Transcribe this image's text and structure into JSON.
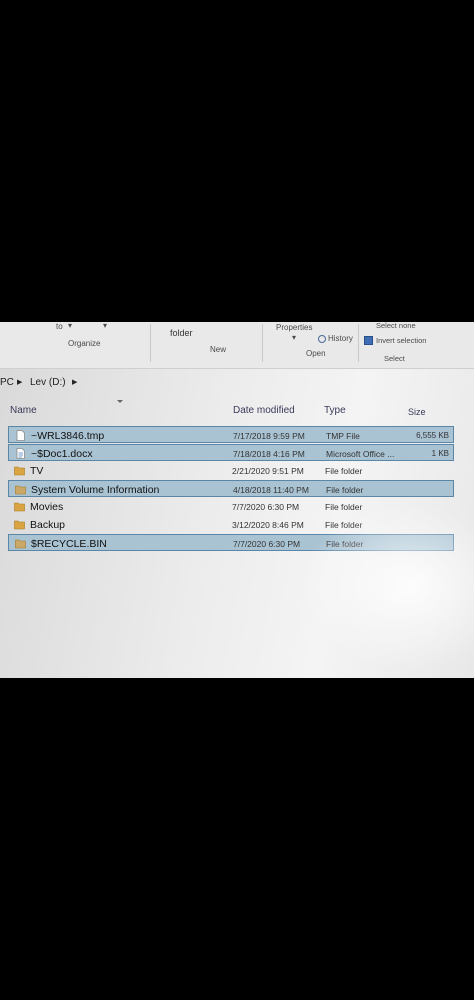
{
  "ribbon": {
    "to_label": "to",
    "folder_label": "folder",
    "organize_label": "Organize",
    "new_label": "New",
    "properties_label": "Properties",
    "open_label": "Open",
    "history_label": "History",
    "select_none_label": "Select none",
    "invert_selection_label": "Invert selection",
    "select_label": "Select"
  },
  "address": {
    "prefix": "PC",
    "current": "Lev (D:)"
  },
  "columns": {
    "name": "Name",
    "date": "Date modified",
    "type": "Type",
    "size": "Size"
  },
  "files": [
    {
      "name": "~WRL3846.tmp",
      "date": "7/17/2018 9:59 PM",
      "type": "TMP File",
      "size": "6,555 KB",
      "icon": "file-icon",
      "selected": true
    },
    {
      "name": "~$Doc1.docx",
      "date": "7/18/2018 4:16 PM",
      "type": "Microsoft Office ...",
      "size": "1 KB",
      "icon": "document-icon",
      "selected": true
    },
    {
      "name": "TV",
      "date": "2/21/2020 9:51 PM",
      "type": "File folder",
      "size": "",
      "icon": "folder-icon",
      "selected": false
    },
    {
      "name": "System Volume Information",
      "date": "4/18/2018 11:40 PM",
      "type": "File folder",
      "size": "",
      "icon": "folder-icon",
      "selected": true
    },
    {
      "name": "Movies",
      "date": "7/7/2020 6:30 PM",
      "type": "File folder",
      "size": "",
      "icon": "folder-icon",
      "selected": false
    },
    {
      "name": "Backup",
      "date": "3/12/2020 8:46 PM",
      "type": "File folder",
      "size": "",
      "icon": "folder-icon",
      "selected": false
    },
    {
      "name": "$RECYCLE.BIN",
      "date": "7/7/2020 6:30 PM",
      "type": "File folder",
      "size": "",
      "icon": "folder-icon",
      "selected": true
    }
  ],
  "colors": {
    "selection": "#a9c3d3",
    "selection_border": "#5a86a8",
    "folder": "#d9a441"
  }
}
